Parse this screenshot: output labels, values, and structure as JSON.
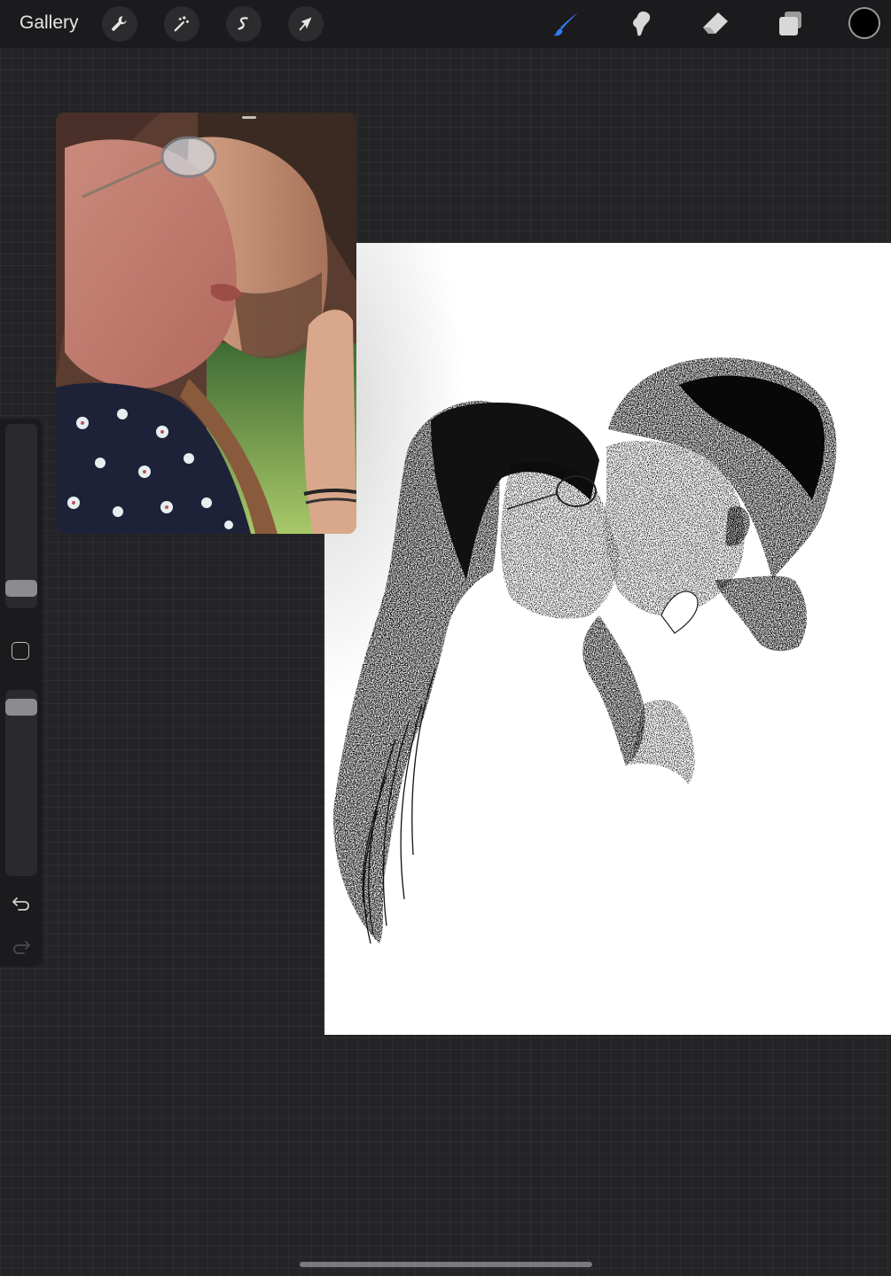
{
  "toolbar": {
    "gallery_label": "Gallery",
    "left_tools": [
      {
        "name": "actions",
        "icon": "wrench-icon"
      },
      {
        "name": "adjustments",
        "icon": "magic-wand-icon"
      },
      {
        "name": "selection",
        "icon": "selection-s-icon"
      },
      {
        "name": "transform",
        "icon": "arrow-cursor-icon"
      }
    ],
    "right_tools": [
      {
        "name": "paint",
        "icon": "brush-icon",
        "active": true,
        "color": "#2f7bf5"
      },
      {
        "name": "smudge",
        "icon": "smudge-finger-icon",
        "active": false
      },
      {
        "name": "erase",
        "icon": "eraser-icon",
        "active": false
      },
      {
        "name": "layers",
        "icon": "layers-icon",
        "active": false
      }
    ],
    "current_color": "#000000"
  },
  "sidebar": {
    "brush_size_level": 0.07,
    "brush_opacity_level": 0.95,
    "modify_icon": "square-icon",
    "undo_icon": "undo-icon",
    "redo_icon": "redo-icon",
    "redo_enabled": false
  },
  "reference": {
    "kind": "photo",
    "subject": "couple-kissing-reference-photo"
  },
  "canvas": {
    "background": "#ffffff",
    "artwork": "stippled-couple-kissing-drawing"
  },
  "colors": {
    "app_background": "#242426",
    "toolbar_background": "#1b1b1d",
    "accent": "#2f7bf5"
  }
}
